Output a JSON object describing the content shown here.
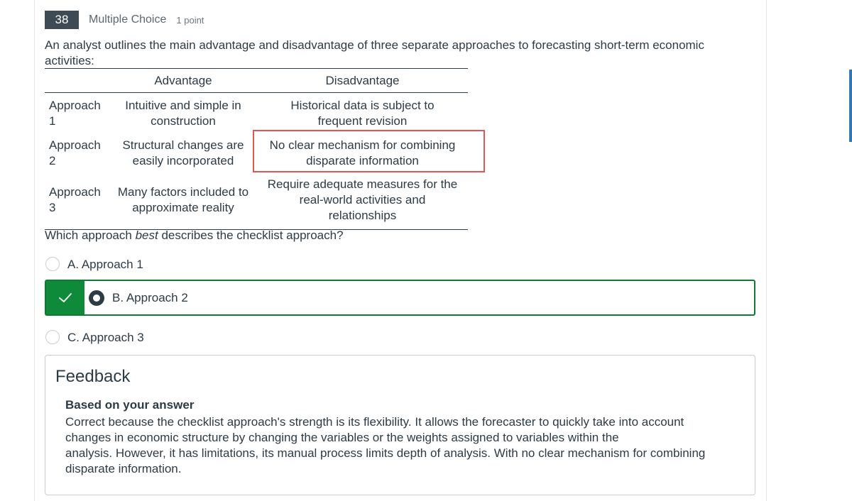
{
  "question": {
    "number": "38",
    "type": "Multiple Choice",
    "points": "1 point",
    "stem": "An analyst outlines the main advantage and disadvantage of three separate approaches to forecasting short-term economic activities:",
    "prompt_pre": "Which approach ",
    "prompt_em": "best",
    "prompt_post": " describes the checklist approach?"
  },
  "table": {
    "headers": {
      "advantage": "Advantage",
      "disadvantage": "Disadvantage"
    },
    "rows": [
      {
        "label_line1": "Approach",
        "label_line2": "1",
        "adv_line1": "Intuitive and simple in",
        "adv_line2": "construction",
        "dis_line1": "Historical data is subject to",
        "dis_line2": "frequent revision",
        "dis_line3": ""
      },
      {
        "label_line1": "Approach",
        "label_line2": "2",
        "adv_line1": "Structural changes are",
        "adv_line2": "easily incorporated",
        "dis_line1": "No clear mechanism for combining",
        "dis_line2": "disparate information",
        "dis_line3": ""
      },
      {
        "label_line1": "Approach",
        "label_line2": "3",
        "adv_line1": "Many factors included to",
        "adv_line2": "approximate reality",
        "dis_line1": "Require adequate measures for the",
        "dis_line2": "real-world activities and",
        "dis_line3": "relationships"
      }
    ]
  },
  "options": [
    {
      "label": "A. Approach 1",
      "selected": false
    },
    {
      "label": "B. Approach 2",
      "selected": true,
      "correct": true
    },
    {
      "label": "C. Approach 3",
      "selected": false
    }
  ],
  "feedback": {
    "title": "Feedback",
    "subtitle": "Based on your answer",
    "line1": "Correct because the checklist approach's strength is its flexibility. It allows the forecaster to quickly take into account",
    "line2": "changes in economic structure by changing the variables or the weights assigned to variables within the",
    "line3": "analysis. However, it has limitations, its manual process limits depth of analysis. With no clear mechanism for combining",
    "line4": "disparate information."
  },
  "colors": {
    "correct_green": "#0f8a3a",
    "highlight_red": "#e25555",
    "badge_dark": "#3e4a54"
  },
  "icons": {
    "correct": "checkmark-icon"
  }
}
